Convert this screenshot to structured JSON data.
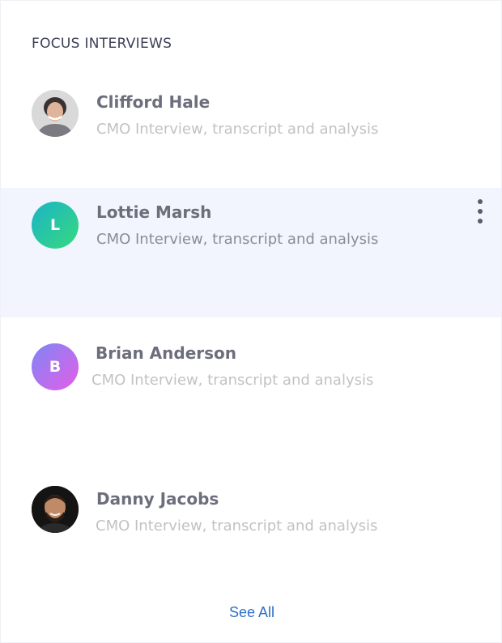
{
  "header": {
    "title": "FOCUS INTERVIEWS"
  },
  "interviews": [
    {
      "name": "Clifford Hale",
      "subtitle": "CMO Interview, transcript and analysis",
      "avatar": {
        "type": "photo",
        "icon": "person-photo-icon"
      }
    },
    {
      "name": "Lottie Marsh",
      "subtitle": "CMO Interview, transcript and analysis",
      "avatar": {
        "type": "initial",
        "initial": "L",
        "colors": [
          "#1bb4c6",
          "#37d97e"
        ]
      },
      "active": true,
      "menu_icon": "more-vertical-icon"
    },
    {
      "name": "Brian Anderson",
      "subtitle": "CMO Interview, transcript and analysis",
      "avatar": {
        "type": "initial",
        "initial": "B",
        "colors": [
          "#7e86f4",
          "#e45ee8"
        ]
      }
    },
    {
      "name": "Danny Jacobs",
      "subtitle": "CMO Interview, transcript and analysis",
      "avatar": {
        "type": "photo",
        "icon": "person-photo-icon"
      }
    }
  ],
  "footer": {
    "see_all_label": "See All"
  },
  "colors": {
    "accent": "#2e6fc4",
    "active_row": "#f2f5fd",
    "title": "#3d4057"
  }
}
